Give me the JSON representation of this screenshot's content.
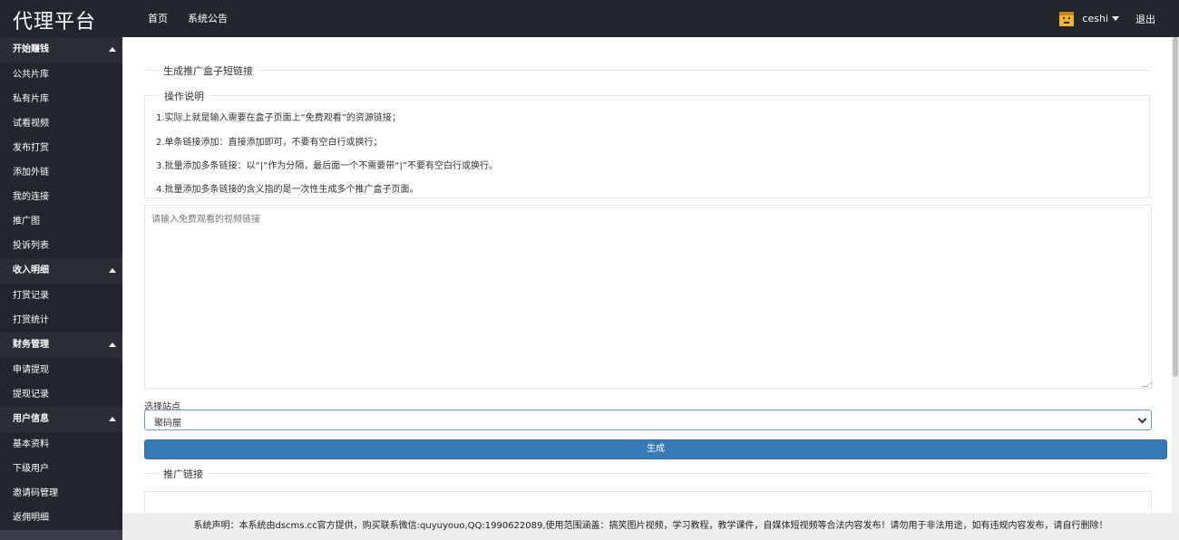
{
  "header": {
    "logo": "代理平台",
    "nav": [
      "首页",
      "系统公告"
    ],
    "username": "ceshi",
    "logout": "退出"
  },
  "sidebar": {
    "groups": [
      {
        "title": "开始赚钱",
        "items": [
          "公共片库",
          "私有片库",
          "试看视频",
          "发布打赏",
          "添加外链",
          "我的连接",
          "推广图",
          "投诉列表"
        ]
      },
      {
        "title": "收入明细",
        "items": [
          "打赏记录",
          "打赏统计"
        ]
      },
      {
        "title": "财务管理",
        "items": [
          "申请提现",
          "提现记录"
        ]
      },
      {
        "title": "用户信息",
        "items": [
          "基本资料",
          "下级用户",
          "邀请码管理",
          "返佣明细"
        ]
      }
    ]
  },
  "main": {
    "section_title": "生成推广盒子短链接",
    "instructions_title": "操作说明",
    "instructions": [
      "1.实际上就是输入需要在盒子页面上“免费观看”的资源链接；",
      "2.单条链接添加：直接添加即可，不要有空白行或换行；",
      "3.批量添加多条链接：以“|”作为分隔，最后面一个不需要带“|”不要有空白行或换行。",
      "4.批量添加多条链接的含义指的是一次性生成多个推广盒子页面。"
    ],
    "textarea_placeholder": "请输入免费观看的视频链接",
    "select_label": "选择站点",
    "select_value": "聚码屋",
    "generate_button": "生成",
    "result_title": "推广链接"
  },
  "footer": {
    "text": "系统声明：本系统由dscms.cc官方提供，购买联系微信:quyuyouo,QQ:1990622089,使用范围涵盖：搞笑图片视频，学习教程，教学课件，自媒体短视频等合法内容发布！请勿用于非法用途，如有违规内容发布，请自行删除！"
  },
  "colors": {
    "topbar": "#23262e",
    "sidebar_group": "#2b2e37",
    "sidebar_item": "#23262e",
    "primary_button": "#337ab7",
    "select_border": "#5e9fd3"
  },
  "icons": {
    "avatar": "golden-avatar-icon"
  }
}
